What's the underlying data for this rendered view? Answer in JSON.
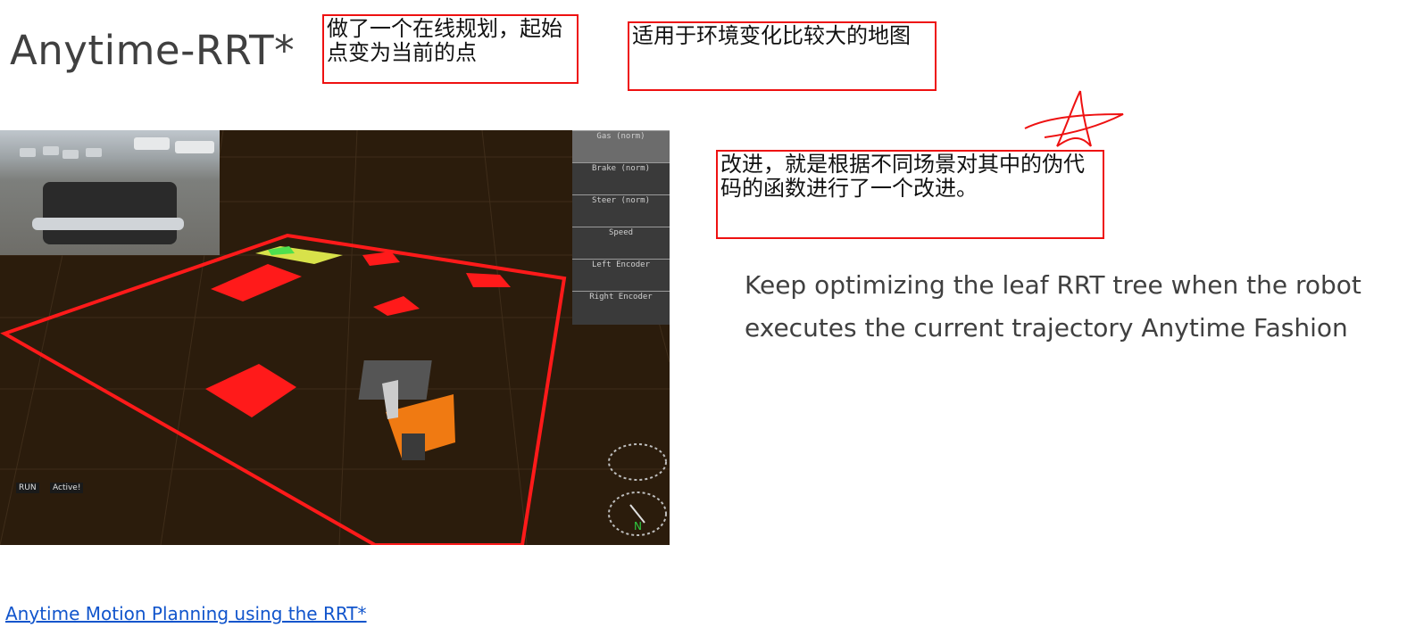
{
  "slide": {
    "title": "Anytime-RRT*",
    "body_line1": "Keep optimizing the leaf RRT tree when the robot",
    "body_line2": "executes the current trajectory Anytime Fashion",
    "link": "Anytime Motion Planning using the RRT*"
  },
  "annotations": {
    "box1": "做了一个在线规划，起始点变为当前的点",
    "box2": "适用于环境变化比较大的地图",
    "box3": "改进，就是根据不同场景对其中的伪代码的函数进行了一个改进。"
  },
  "simulator": {
    "panel_labels": [
      "Gas (norm)",
      "Brake (norm)",
      "Steer (norm)",
      "Speed",
      "Left Encoder",
      "Right Encoder"
    ],
    "status_run": "RUN",
    "status_active": "Active!"
  },
  "colors": {
    "annotation": "#ee1111",
    "link": "#1155cc",
    "text": "#404040",
    "ground": "#2b1c0c"
  }
}
